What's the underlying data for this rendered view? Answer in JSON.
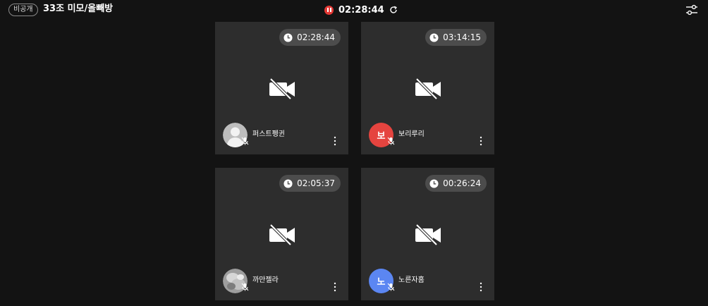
{
  "header": {
    "privacy_badge": "비공개",
    "room_title": "33조 미모/올빼방",
    "recording_time": "02:28:44",
    "recording_status_color": "#e53935",
    "pause_icon": "pause-circle-icon",
    "refresh_icon": "refresh-icon",
    "settings_icon": "sliders-icon"
  },
  "participants": [
    {
      "name": "퍼스트펭귄",
      "timer": "02:28:44",
      "avatar_type": "photo",
      "avatar_initial": "",
      "camera": "off",
      "mic": "off"
    },
    {
      "name": "보리루리",
      "timer": "03:14:15",
      "avatar_type": "initial",
      "avatar_initial": "보",
      "avatar_color": "#e5443f",
      "camera": "off",
      "mic": "off"
    },
    {
      "name": "까만젤라",
      "timer": "02:05:37",
      "avatar_type": "photo",
      "avatar_initial": "",
      "camera": "off",
      "mic": "off"
    },
    {
      "name": "노른자홈",
      "timer": "00:26:24",
      "avatar_type": "initial",
      "avatar_initial": "노",
      "avatar_color": "#5b86f2",
      "camera": "off",
      "mic": "off"
    }
  ]
}
